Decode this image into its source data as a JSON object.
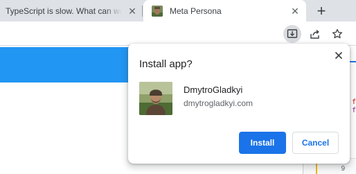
{
  "tabs": [
    {
      "title": "TypeScript is slow. What can we",
      "active": false,
      "close_glyph": "✕"
    },
    {
      "title": "Meta Persona",
      "active": true,
      "close_glyph": "✕",
      "favicon": "avatar-favicon"
    }
  ],
  "new_tab_glyph": "+",
  "toolbar": {
    "icons": [
      "install-app-icon",
      "share-icon",
      "bookmark-star-icon"
    ]
  },
  "colors": {
    "accent": "#1a73e8",
    "page_header": "#2196f3",
    "tabstrip": "#dee1e6"
  },
  "dialog": {
    "title": "Install app?",
    "close_glyph": "✕",
    "app_name": "DmytroGladkyi",
    "app_origin": "dmytrogladkyi.com",
    "install_label": "Install",
    "cancel_label": "Cancel"
  },
  "devtools": {
    "text_fragment": "f",
    "line_number": "9"
  }
}
